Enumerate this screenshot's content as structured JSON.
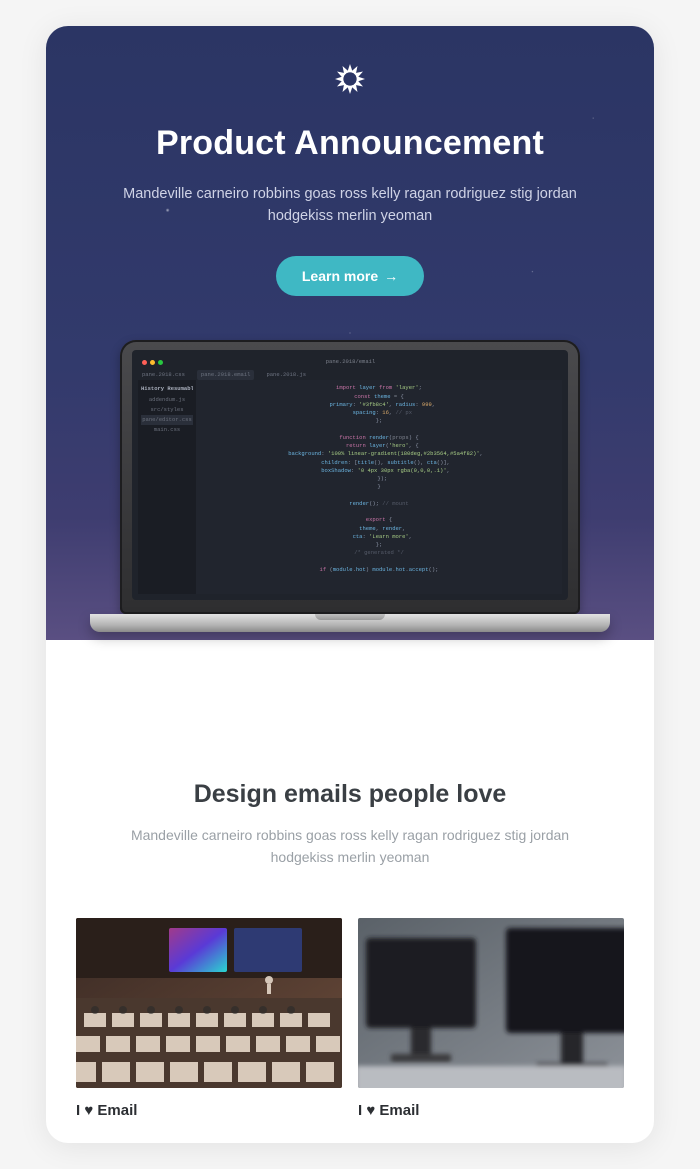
{
  "hero": {
    "title": "Product Announcement",
    "subtitle": "Mandeville carneiro robbins goas ross kelly ragan rodriguez stig jordan hodgekiss merlin yeoman",
    "cta_label": "Learn more",
    "cta_arrow": "→"
  },
  "section": {
    "title": "Design emails people love",
    "subtitle": "Mandeville carneiro robbins goas ross kelly ragan rodriguez stig jordan hodgekiss merlin yeoman"
  },
  "cards": [
    {
      "title": "I ♥ Email"
    },
    {
      "title": "I ♥ Email"
    }
  ],
  "colors": {
    "cta": "#3fb8c4",
    "hero_bg_top": "#2b3564",
    "hero_bg_bottom": "#5a4f82"
  },
  "icons": {
    "logo": "sunburst-logo-icon",
    "arrow_right": "arrow-right-icon"
  },
  "editor_mock": {
    "filename_center": "pane.2018/email",
    "tabs": [
      "pane.2018.css",
      "pane.2018.email",
      "pane.2018.js"
    ],
    "sidebar_title": "History Resumable",
    "sidebar_items": [
      "addendum.js",
      "src/styles",
      "pane/editor.css",
      "main.css"
    ]
  }
}
